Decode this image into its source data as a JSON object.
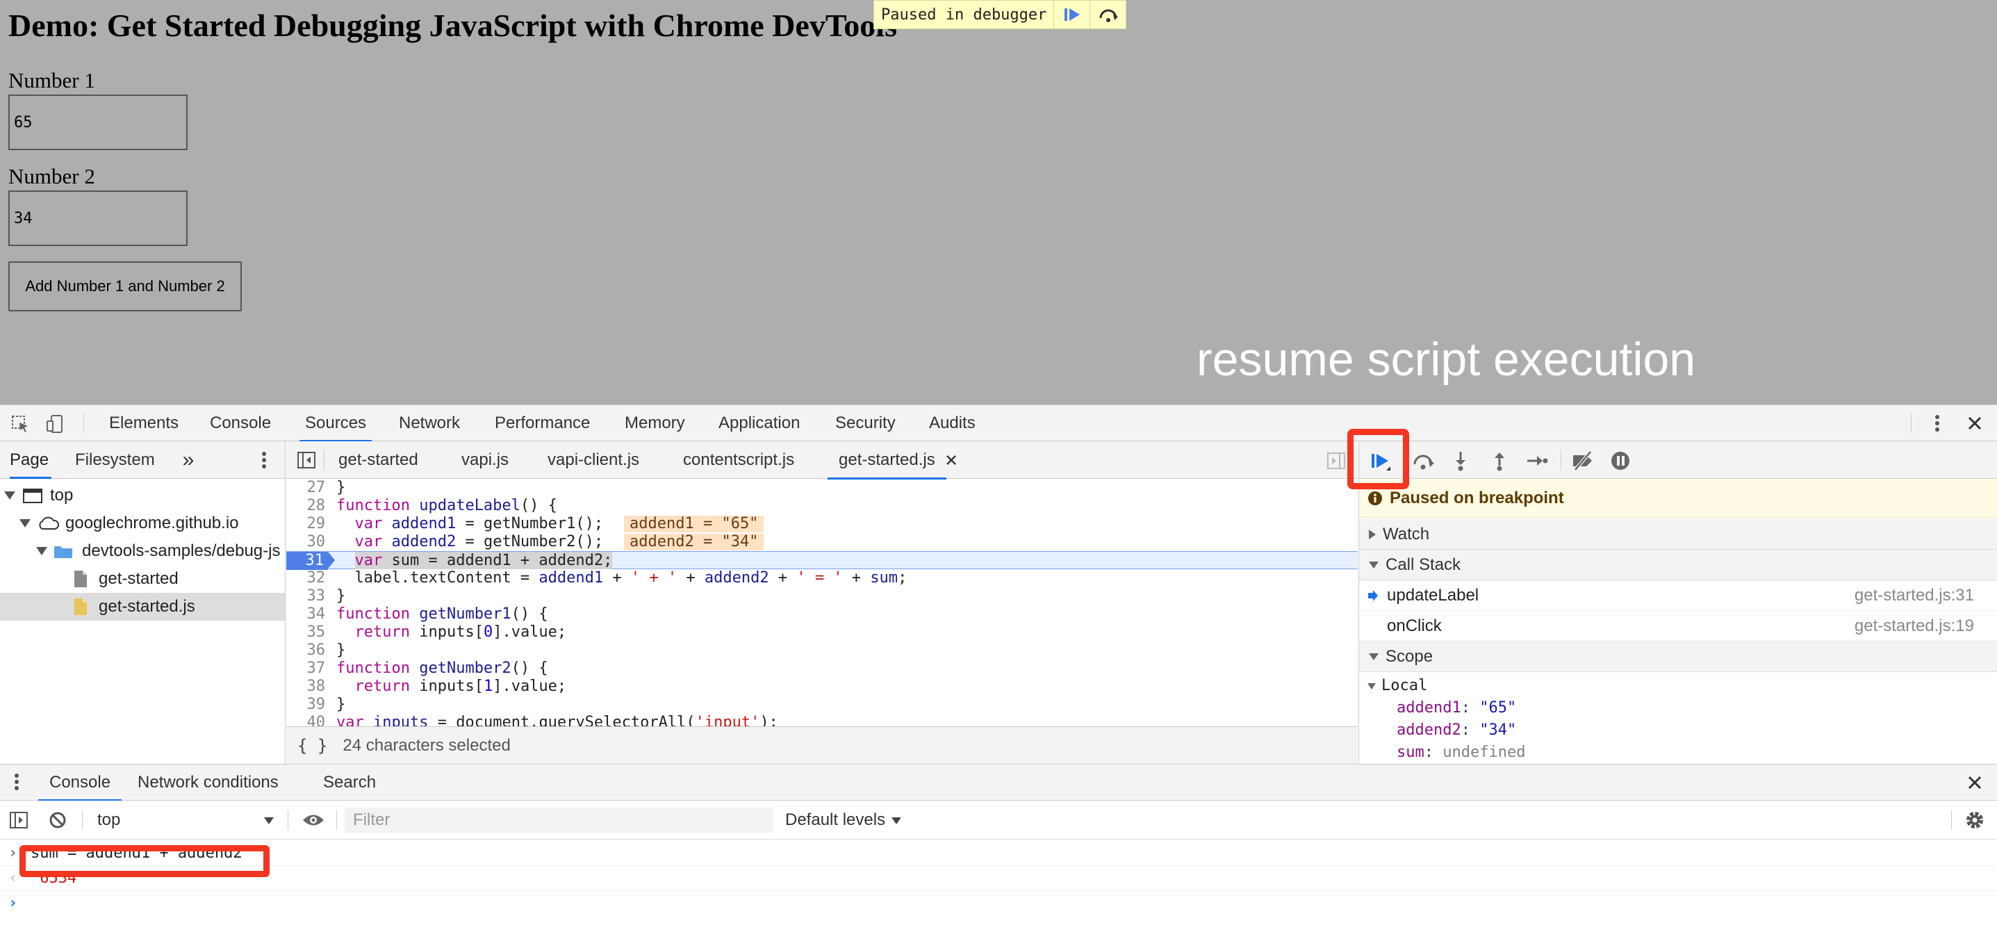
{
  "page": {
    "heading": "Demo: Get Started Debugging JavaScript with Chrome DevTools",
    "number1_label": "Number 1",
    "number1_value": "65",
    "number2_label": "Number 2",
    "number2_value": "34",
    "add_button": "Add Number 1 and Number 2",
    "paused_overlay": "Paused in debugger",
    "annotation": "resume script execution"
  },
  "devtools": {
    "main_tabs": [
      "Elements",
      "Console",
      "Sources",
      "Network",
      "Performance",
      "Memory",
      "Application",
      "Security",
      "Audits"
    ],
    "active_main_tab": "Sources",
    "navigator": {
      "tabs": [
        "Page",
        "Filesystem"
      ],
      "tree": [
        "top",
        "googlechrome.github.io",
        "devtools-samples/debug-js",
        "get-started",
        "get-started.js"
      ]
    },
    "editor": {
      "tabs": [
        "get-started",
        "vapi.js",
        "vapi-client.js",
        "contentscript.js",
        "get-started.js"
      ],
      "status": "24 characters selected",
      "format_label": "{ }",
      "line_numbers": [
        "27",
        "28",
        "29",
        "30",
        "31",
        "32",
        "33",
        "34",
        "35",
        "36",
        "37",
        "38",
        "39",
        "40"
      ],
      "inline_values": [
        "addend1 = \"65\"",
        "addend2 = \"34\""
      ]
    },
    "debugger": {
      "paused_message": "Paused on breakpoint",
      "watch_label": "Watch",
      "call_stack_label": "Call Stack",
      "call_stack": [
        {
          "fn": "updateLabel",
          "loc": "get-started.js:31"
        },
        {
          "fn": "onClick",
          "loc": "get-started.js:19"
        }
      ],
      "scope_label": "Scope",
      "local_label": "Local",
      "scope_vars": [
        {
          "name": "addend1",
          "value": "\"65\""
        },
        {
          "name": "addend2",
          "value": "\"34\""
        },
        {
          "name": "sum",
          "value": "undefined"
        }
      ]
    },
    "drawer": {
      "tabs": [
        "Console",
        "Network conditions",
        "Search"
      ],
      "context": "top",
      "filter_placeholder": "Filter",
      "levels": "Default levels",
      "command": "sum = addend1 + addend2",
      "result": "\"6534\""
    }
  },
  "colors": {
    "accent": "#1a73e8",
    "highlight_box": "#f4351f",
    "execution_line": "#4f7fe6",
    "paused_banner": "#fffbe5"
  }
}
